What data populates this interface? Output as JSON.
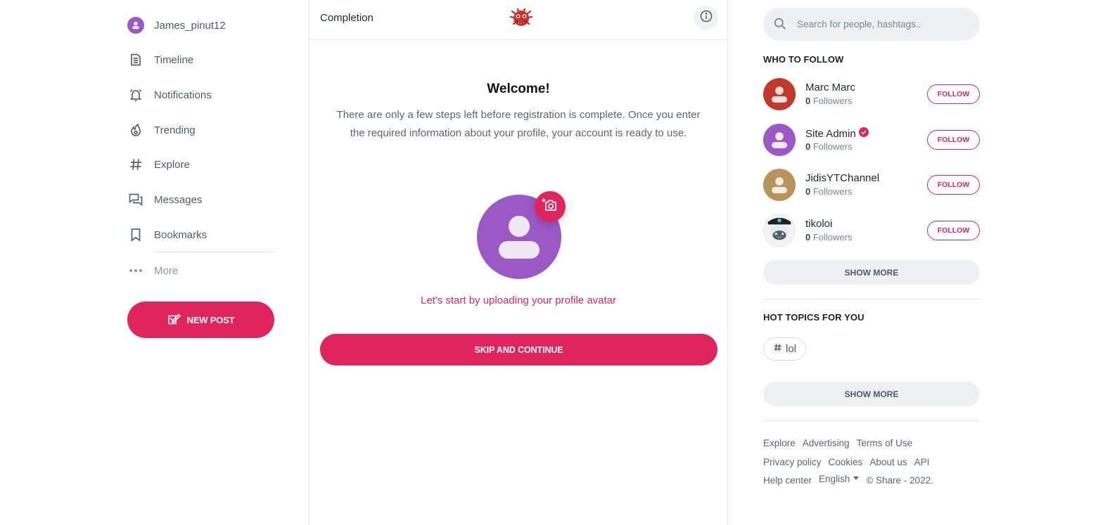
{
  "sidebar": {
    "username": "James_pinut12",
    "items": [
      {
        "label": "Timeline",
        "icon": "timeline-icon"
      },
      {
        "label": "Notifications",
        "icon": "bell-icon"
      },
      {
        "label": "Trending",
        "icon": "flame-icon"
      },
      {
        "label": "Explore",
        "icon": "hashtag-icon"
      },
      {
        "label": "Messages",
        "icon": "chat-icon"
      },
      {
        "label": "Bookmarks",
        "icon": "bookmark-icon"
      }
    ],
    "more_label": "More",
    "new_post_label": "NEW POST"
  },
  "main": {
    "header_title": "Completion",
    "welcome_title": "Welcome!",
    "description": "There are only a few steps left before registration is complete. Once you enter the required information about your profile, your account is ready to use.",
    "upload_prompt": "Let's start by uploading your profile avatar",
    "skip_label": "SKIP AND CONTINUE"
  },
  "right": {
    "search_placeholder": "Search for people, hashtags..",
    "who_to_follow_title": "WHO TO FOLLOW",
    "suggestions": [
      {
        "name": "Marc Marc",
        "followers_count": "0",
        "followers_label": "Followers",
        "verified": false,
        "avatar_color": "#c0392b"
      },
      {
        "name": "Site Admin",
        "followers_count": "0",
        "followers_label": "Followers",
        "verified": true,
        "avatar_color": "#9b59c6"
      },
      {
        "name": "JidisYTChannel",
        "followers_count": "0",
        "followers_label": "Followers",
        "verified": false,
        "avatar_color": "#b8935a"
      },
      {
        "name": "tikoloi",
        "followers_count": "0",
        "followers_label": "Followers",
        "verified": false,
        "avatar_color": "#2a2f36"
      }
    ],
    "follow_label": "FOLLOW",
    "show_more_label": "SHOW MORE",
    "hot_topics_title": "HOT TOPICS FOR YOU",
    "topics": [
      "lol"
    ],
    "footer": {
      "row1": [
        "Explore",
        "Advertising",
        "Terms of Use"
      ],
      "row2": [
        "Privacy policy",
        "Cookies",
        "About us",
        "API"
      ],
      "help": "Help center",
      "language": "English",
      "copyright": "© Share - 2022."
    }
  },
  "colors": {
    "accent": "#e0245e",
    "avatar_default": "#9b59c6",
    "text_muted": "#5b6573"
  }
}
